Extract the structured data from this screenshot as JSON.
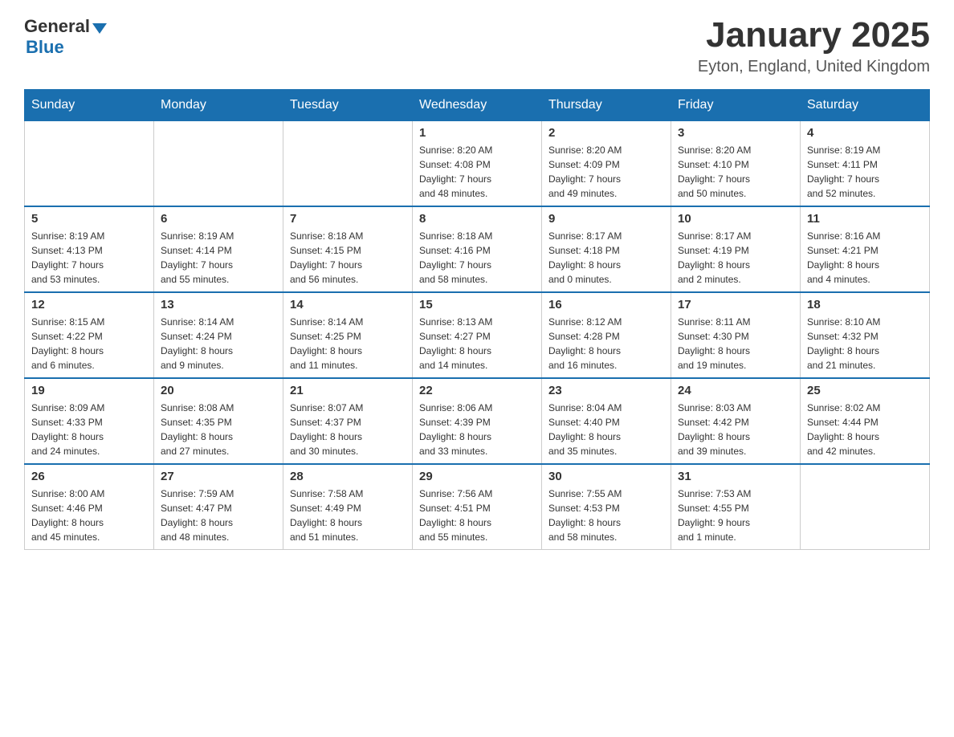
{
  "header": {
    "logo_general": "General",
    "logo_blue": "Blue",
    "title": "January 2025",
    "subtitle": "Eyton, England, United Kingdom"
  },
  "days_of_week": [
    "Sunday",
    "Monday",
    "Tuesday",
    "Wednesday",
    "Thursday",
    "Friday",
    "Saturday"
  ],
  "weeks": [
    {
      "days": [
        {
          "number": "",
          "info": ""
        },
        {
          "number": "",
          "info": ""
        },
        {
          "number": "",
          "info": ""
        },
        {
          "number": "1",
          "info": "Sunrise: 8:20 AM\nSunset: 4:08 PM\nDaylight: 7 hours\nand 48 minutes."
        },
        {
          "number": "2",
          "info": "Sunrise: 8:20 AM\nSunset: 4:09 PM\nDaylight: 7 hours\nand 49 minutes."
        },
        {
          "number": "3",
          "info": "Sunrise: 8:20 AM\nSunset: 4:10 PM\nDaylight: 7 hours\nand 50 minutes."
        },
        {
          "number": "4",
          "info": "Sunrise: 8:19 AM\nSunset: 4:11 PM\nDaylight: 7 hours\nand 52 minutes."
        }
      ]
    },
    {
      "days": [
        {
          "number": "5",
          "info": "Sunrise: 8:19 AM\nSunset: 4:13 PM\nDaylight: 7 hours\nand 53 minutes."
        },
        {
          "number": "6",
          "info": "Sunrise: 8:19 AM\nSunset: 4:14 PM\nDaylight: 7 hours\nand 55 minutes."
        },
        {
          "number": "7",
          "info": "Sunrise: 8:18 AM\nSunset: 4:15 PM\nDaylight: 7 hours\nand 56 minutes."
        },
        {
          "number": "8",
          "info": "Sunrise: 8:18 AM\nSunset: 4:16 PM\nDaylight: 7 hours\nand 58 minutes."
        },
        {
          "number": "9",
          "info": "Sunrise: 8:17 AM\nSunset: 4:18 PM\nDaylight: 8 hours\nand 0 minutes."
        },
        {
          "number": "10",
          "info": "Sunrise: 8:17 AM\nSunset: 4:19 PM\nDaylight: 8 hours\nand 2 minutes."
        },
        {
          "number": "11",
          "info": "Sunrise: 8:16 AM\nSunset: 4:21 PM\nDaylight: 8 hours\nand 4 minutes."
        }
      ]
    },
    {
      "days": [
        {
          "number": "12",
          "info": "Sunrise: 8:15 AM\nSunset: 4:22 PM\nDaylight: 8 hours\nand 6 minutes."
        },
        {
          "number": "13",
          "info": "Sunrise: 8:14 AM\nSunset: 4:24 PM\nDaylight: 8 hours\nand 9 minutes."
        },
        {
          "number": "14",
          "info": "Sunrise: 8:14 AM\nSunset: 4:25 PM\nDaylight: 8 hours\nand 11 minutes."
        },
        {
          "number": "15",
          "info": "Sunrise: 8:13 AM\nSunset: 4:27 PM\nDaylight: 8 hours\nand 14 minutes."
        },
        {
          "number": "16",
          "info": "Sunrise: 8:12 AM\nSunset: 4:28 PM\nDaylight: 8 hours\nand 16 minutes."
        },
        {
          "number": "17",
          "info": "Sunrise: 8:11 AM\nSunset: 4:30 PM\nDaylight: 8 hours\nand 19 minutes."
        },
        {
          "number": "18",
          "info": "Sunrise: 8:10 AM\nSunset: 4:32 PM\nDaylight: 8 hours\nand 21 minutes."
        }
      ]
    },
    {
      "days": [
        {
          "number": "19",
          "info": "Sunrise: 8:09 AM\nSunset: 4:33 PM\nDaylight: 8 hours\nand 24 minutes."
        },
        {
          "number": "20",
          "info": "Sunrise: 8:08 AM\nSunset: 4:35 PM\nDaylight: 8 hours\nand 27 minutes."
        },
        {
          "number": "21",
          "info": "Sunrise: 8:07 AM\nSunset: 4:37 PM\nDaylight: 8 hours\nand 30 minutes."
        },
        {
          "number": "22",
          "info": "Sunrise: 8:06 AM\nSunset: 4:39 PM\nDaylight: 8 hours\nand 33 minutes."
        },
        {
          "number": "23",
          "info": "Sunrise: 8:04 AM\nSunset: 4:40 PM\nDaylight: 8 hours\nand 35 minutes."
        },
        {
          "number": "24",
          "info": "Sunrise: 8:03 AM\nSunset: 4:42 PM\nDaylight: 8 hours\nand 39 minutes."
        },
        {
          "number": "25",
          "info": "Sunrise: 8:02 AM\nSunset: 4:44 PM\nDaylight: 8 hours\nand 42 minutes."
        }
      ]
    },
    {
      "days": [
        {
          "number": "26",
          "info": "Sunrise: 8:00 AM\nSunset: 4:46 PM\nDaylight: 8 hours\nand 45 minutes."
        },
        {
          "number": "27",
          "info": "Sunrise: 7:59 AM\nSunset: 4:47 PM\nDaylight: 8 hours\nand 48 minutes."
        },
        {
          "number": "28",
          "info": "Sunrise: 7:58 AM\nSunset: 4:49 PM\nDaylight: 8 hours\nand 51 minutes."
        },
        {
          "number": "29",
          "info": "Sunrise: 7:56 AM\nSunset: 4:51 PM\nDaylight: 8 hours\nand 55 minutes."
        },
        {
          "number": "30",
          "info": "Sunrise: 7:55 AM\nSunset: 4:53 PM\nDaylight: 8 hours\nand 58 minutes."
        },
        {
          "number": "31",
          "info": "Sunrise: 7:53 AM\nSunset: 4:55 PM\nDaylight: 9 hours\nand 1 minute."
        },
        {
          "number": "",
          "info": ""
        }
      ]
    }
  ]
}
